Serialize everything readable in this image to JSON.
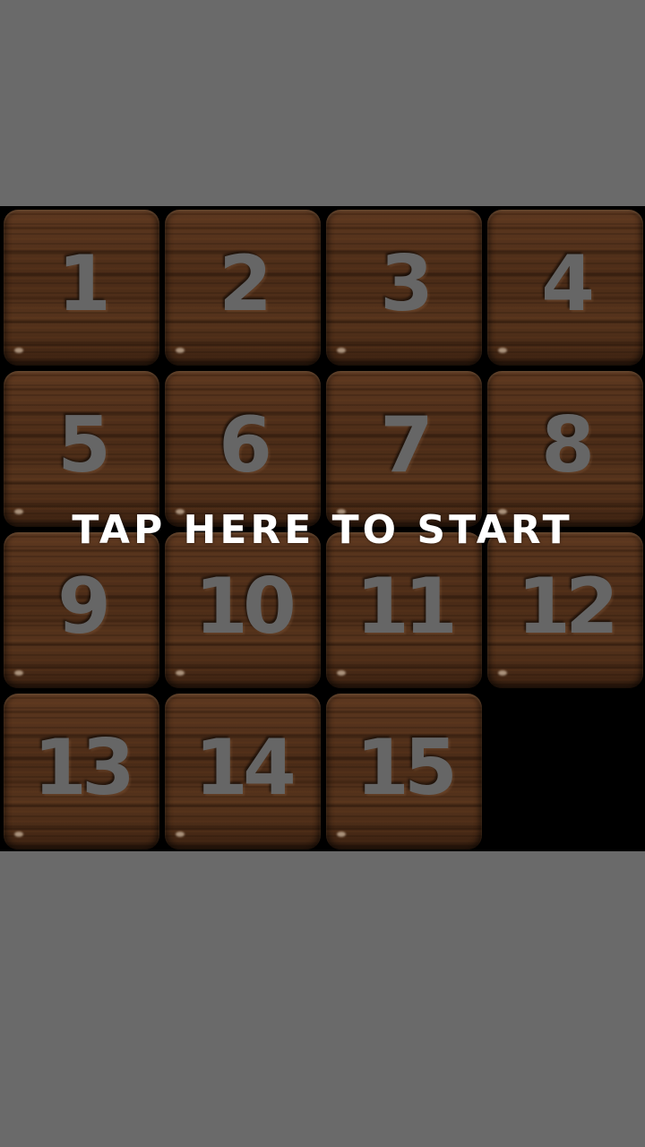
{
  "game": {
    "tiles": [
      "1",
      "2",
      "3",
      "4",
      "5",
      "6",
      "7",
      "8",
      "9",
      "10",
      "11",
      "12",
      "13",
      "14",
      "15"
    ],
    "empty_slot": 16,
    "overlay_text": "TAP HERE TO START"
  },
  "colors": {
    "background": "#6a6a6a",
    "board": "#000000",
    "tile_wood": "#4a2b17",
    "tile_number": "#666666",
    "overlay_text": "#ffffff"
  }
}
